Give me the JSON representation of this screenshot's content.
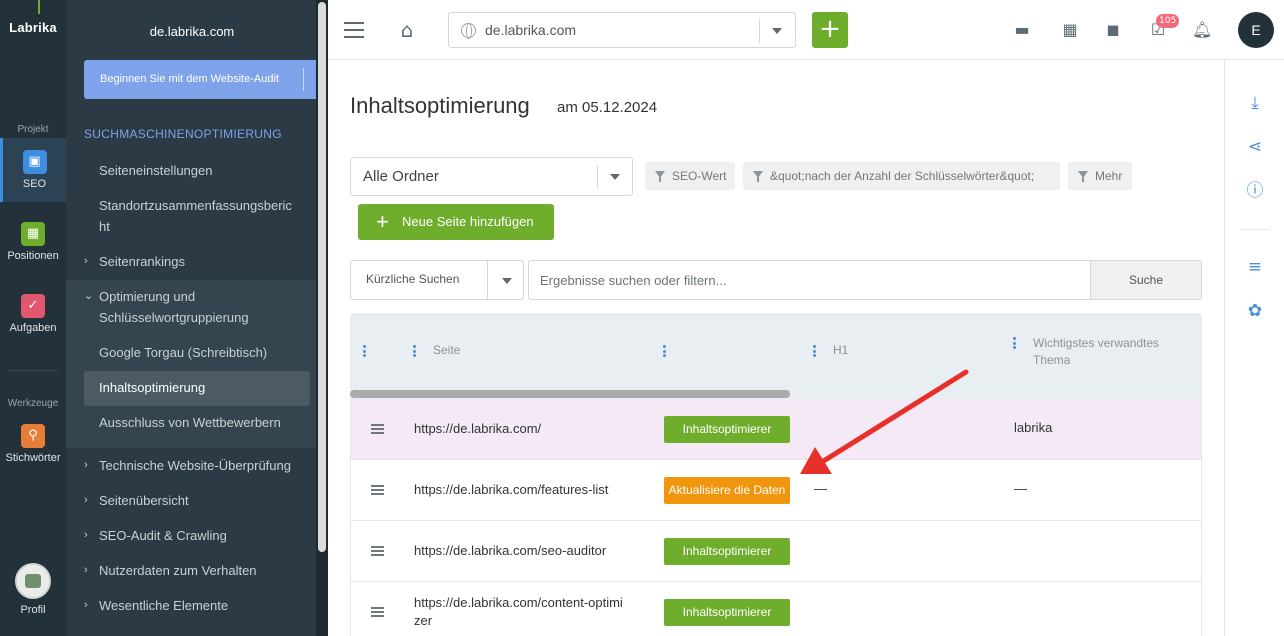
{
  "rail": {
    "logo": "Labrika",
    "section_project": "Projekt",
    "section_tools": "Werkzeuge",
    "items": [
      {
        "label": "SEO",
        "color": "#3d8ee0",
        "icon": "seo-icon"
      },
      {
        "label": "Positionen",
        "color": "#6fae2d",
        "icon": "chart-icon"
      },
      {
        "label": "Aufgaben",
        "color": "#e0576e",
        "icon": "check-icon"
      },
      {
        "label": "Stichwörter",
        "color": "#e67e3a",
        "icon": "key-icon"
      }
    ],
    "profile_label": "Profil"
  },
  "sidebar": {
    "domain": "de.labrika.com",
    "audit_button": "Beginnen Sie mit dem Website-Audit",
    "heading": "SUCHMASCHINENOPTIMIERUNG",
    "items": [
      "Seiteneinstellungen",
      "Standortzusammenfassungsbericht",
      "Seitenrankings",
      "Optimierung und Schlüsselwortgruppierung",
      "Google Torgau (Schreibtisch)",
      "Inhaltsoptimierung",
      "Ausschluss von Wettbewerbern",
      "Technische Website-Überprüfung",
      "Seitenübersicht",
      "SEO-Audit & Crawling",
      "Nutzerdaten zum Verhalten",
      "Wesentliche Elemente"
    ],
    "item_2_line1": "Standortzusammenfassungsberic",
    "item_2_line2": "ht",
    "item_4_line1": "Optimierung und",
    "item_4_line2": "Schlüsselwortgruppierung"
  },
  "topbar": {
    "domain_value": "de.labrika.com",
    "add_label": "+",
    "notification_count": "105",
    "user_initial": "E"
  },
  "main": {
    "title": "Inhaltsoptimierung",
    "date": "am 05.12.2024",
    "folder_value": "Alle Ordner",
    "filters": [
      "SEO-Wert",
      "&quot;nach der Anzahl der Schlüsselwörter&quot;",
      "Mehr"
    ],
    "new_page_label": "Neue Seite hinzufügen",
    "recent_label": "Kürzliche Suchen",
    "search_placeholder": "Ergebnisse suchen oder filtern...",
    "search_button": "Suche"
  },
  "table": {
    "columns": {
      "page": "Seite",
      "h1": "H1",
      "topic_line1": "Wichtigstes verwandtes",
      "topic_line2": "Thema"
    },
    "rows": [
      {
        "url": "https://de.labrika.com/",
        "status": "Inhaltsoptimierer",
        "status_color": "#6fae2d",
        "h1": "",
        "topic": "labrika"
      },
      {
        "url": "https://de.labrika.com/features-list",
        "status": "Aktualisiere die Daten",
        "status_color": "#f0960e",
        "h1": "—",
        "topic": "—"
      },
      {
        "url": "https://de.labrika.com/seo-auditor",
        "status": "Inhaltsoptimierer",
        "status_color": "#6fae2d",
        "h1": "",
        "topic": ""
      },
      {
        "url_line1": "https://de.labrika.com/content-optimi",
        "url_line2": "zer",
        "status": "Inhaltsoptimierer",
        "status_color": "#6fae2d",
        "h1": "",
        "topic": ""
      }
    ]
  }
}
